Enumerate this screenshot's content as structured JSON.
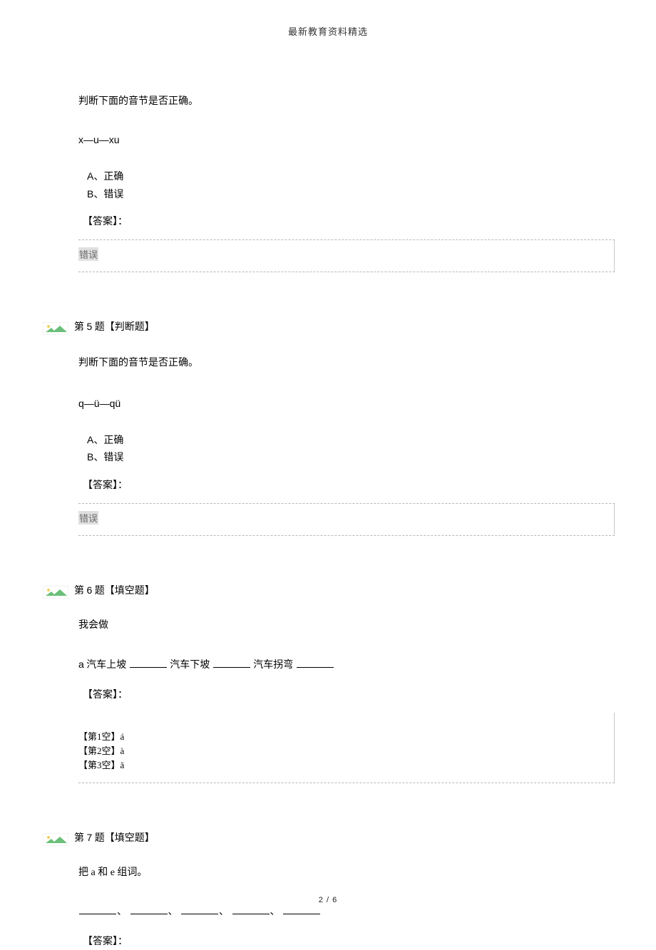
{
  "header": "最新教育资料精选",
  "q4": {
    "instruction": "判断下面的音节是否正确。",
    "expression": "x—u—xu",
    "opt_a_letter": "A",
    "opt_a_text": "、正确",
    "opt_b_letter": "B",
    "opt_b_text": "、错误",
    "answer_label": "【答案】：",
    "answer_value": "错误"
  },
  "q5": {
    "num": "5",
    "title_prefix": "第 ",
    "title_suffix": " 题",
    "type": "【判断题】",
    "instruction": "判断下面的音节是否正确。",
    "expression": "q—ü—qü",
    "opt_a_letter": "A",
    "opt_a_text": "、正确",
    "opt_b_letter": "B",
    "opt_b_text": "、错误",
    "answer_label": "【答案】：",
    "answer_value": "错误"
  },
  "q6": {
    "num": "6",
    "title_prefix": "第 ",
    "title_suffix": " 题",
    "type": "【填空题】",
    "instruction": "我会做",
    "fill_a": "a",
    "fill_part1": " 汽车上坡 ",
    "fill_part2": " 汽车下坡 ",
    "fill_part3": " 汽车拐弯 ",
    "answer_label": "【答案】：",
    "line1": "【第1空】á",
    "line2": "【第2空】à",
    "line3": "【第3空】ǎ"
  },
  "q7": {
    "num": "7",
    "title_prefix": "第 ",
    "title_suffix": " 题",
    "type": "【填空题】",
    "instruction": "把 a 和 e 组词。",
    "sep": "、",
    "answer_label": "【答案】："
  },
  "footer": "2 / 6"
}
